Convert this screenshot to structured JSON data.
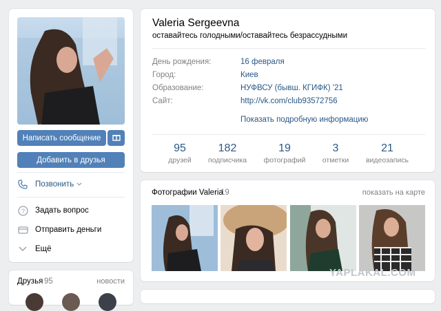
{
  "profile": {
    "name": "Valeria Sergeevna",
    "status": "оставайтесь голодными/оставайтесь безрассудными",
    "info": [
      {
        "label": "День рождения:",
        "value": "16 февраля"
      },
      {
        "label": "Город:",
        "value": "Киев"
      },
      {
        "label": "Образование:",
        "value": "НУФВСУ (бывш. КГИФК) '21"
      },
      {
        "label": "Сайт:",
        "value": "http://vk.com/club93572756"
      }
    ],
    "show_more": "Показать подробную информацию",
    "counters": [
      {
        "num": "95",
        "label": "друзей"
      },
      {
        "num": "182",
        "label": "подписчика"
      },
      {
        "num": "19",
        "label": "фотографий"
      },
      {
        "num": "3",
        "label": "отметки"
      },
      {
        "num": "21",
        "label": "видеозапись"
      }
    ]
  },
  "sidebar": {
    "message_button": "Написать сообщение",
    "add_friend_button": "Добавить в друзья",
    "call": "Позвонить",
    "ask": "Задать вопрос",
    "send_money": "Отправить деньги",
    "more": "Ещё",
    "friends_title": "Друзья",
    "friends_count": "95",
    "friends_news": "новости"
  },
  "photos": {
    "title": "Фотографии Valeria",
    "count": "19",
    "map_link": "показать на карте"
  },
  "watermark": "YAPLAKAL.COM",
  "icons": [
    "gift-icon",
    "phone-icon",
    "chevron-down-icon",
    "question-icon",
    "money-icon"
  ],
  "colors": {
    "accent": "#5181b8",
    "link": "#2a5885",
    "muted": "#828282",
    "background": "#edeef0"
  }
}
